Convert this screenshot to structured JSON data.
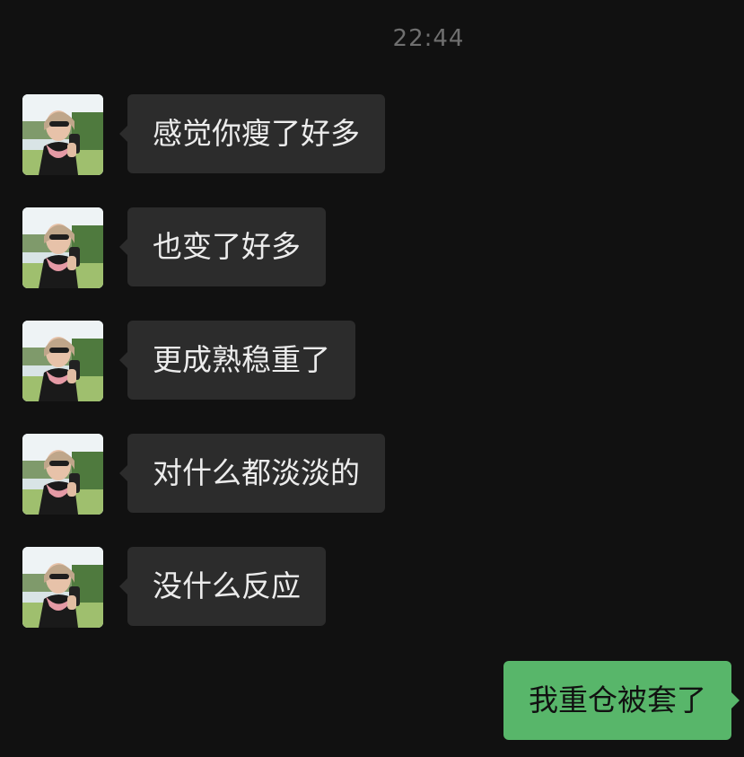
{
  "chat": {
    "timestamp": "22:44",
    "incoming_messages": [
      {
        "text": "感觉你瘦了好多",
        "avatar": "contact-avatar"
      },
      {
        "text": "也变了好多",
        "avatar": "contact-avatar"
      },
      {
        "text": "更成熟稳重了",
        "avatar": "contact-avatar"
      },
      {
        "text": "对什么都淡淡的",
        "avatar": "contact-avatar"
      },
      {
        "text": "没什么反应",
        "avatar": "contact-avatar"
      }
    ],
    "outgoing_message": {
      "text": "我重仓被套了"
    }
  },
  "colors": {
    "background": "#111111",
    "incoming_bubble": "#2c2c2c",
    "outgoing_bubble": "#58b66a",
    "timestamp_text": "#6f6f6f"
  }
}
